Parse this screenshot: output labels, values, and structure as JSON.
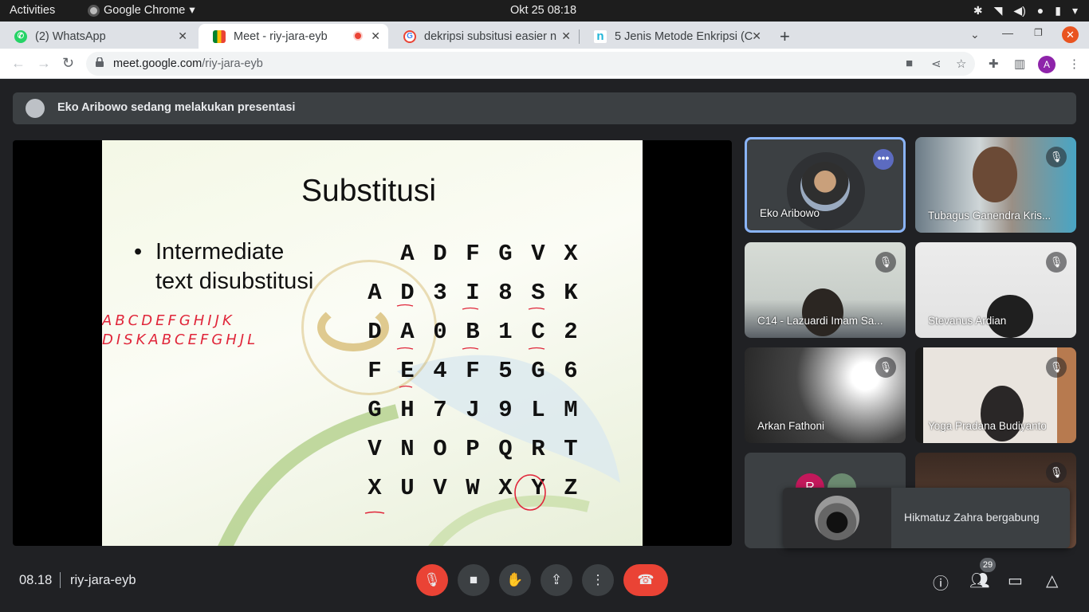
{
  "topbar": {
    "activities": "Activities",
    "app_name": "Google Chrome",
    "clock": "Okt 25  08:18"
  },
  "tabs": [
    {
      "title": "(2) WhatsApp",
      "favicon": "whatsapp-icon",
      "color": "#25d366"
    },
    {
      "title": "Meet - riy-jara-eyb",
      "favicon": "meet-icon",
      "active": true
    },
    {
      "title": "dekripsi subsitusi easier n",
      "favicon": "google-icon"
    },
    {
      "title": "5 Jenis Metode Enkripsi (C",
      "favicon": "n-icon",
      "color": "#1fb5d8"
    }
  ],
  "address": {
    "host": "meet.google.com",
    "path": "/riy-jara-eyb"
  },
  "meet": {
    "presenting": "Eko Aribowo sedang melakukan presentasi",
    "slide": {
      "title": "Substitusi",
      "bullet_line1": "Intermediate",
      "bullet_line2": "text disubstitusi",
      "handwriting_line1": "ABCDEFGHIJK",
      "handwriting_line2": "DISKABCEFGHJL",
      "grid": [
        [
          "",
          "A",
          "D",
          "F",
          "G",
          "V",
          "X"
        ],
        [
          "A",
          "D",
          "3",
          "I",
          "8",
          "S",
          "K"
        ],
        [
          "D",
          "A",
          "0",
          "B",
          "1",
          "C",
          "2"
        ],
        [
          "F",
          "E",
          "4",
          "F",
          "5",
          "G",
          "6"
        ],
        [
          "G",
          "H",
          "7",
          "J",
          "9",
          "L",
          "M"
        ],
        [
          "V",
          "N",
          "O",
          "P",
          "Q",
          "R",
          "T"
        ],
        [
          "X",
          "U",
          "V",
          "W",
          "X",
          "Y",
          "Z"
        ]
      ]
    },
    "participants": [
      {
        "name": "Eko Aribowo"
      },
      {
        "name": "Tubagus Ganendra Kris..."
      },
      {
        "name": "C14 - Lazuardi Imam Sa..."
      },
      {
        "name": "Stevanus Ardian"
      },
      {
        "name": "Arkan Fathoni"
      },
      {
        "name": "Yoga Pradana Budiyanto"
      }
    ],
    "extra_avatar_letter": "R",
    "toast": "Hikmatuz Zahra bergabung",
    "time": "08.18",
    "meeting_code": "riy-jara-eyb",
    "people_count": "29"
  },
  "profile_letter": "A",
  "colors": {
    "accent_red": "#ea4335",
    "active_border": "#8ab4f8",
    "annotation": "#e0263a"
  }
}
